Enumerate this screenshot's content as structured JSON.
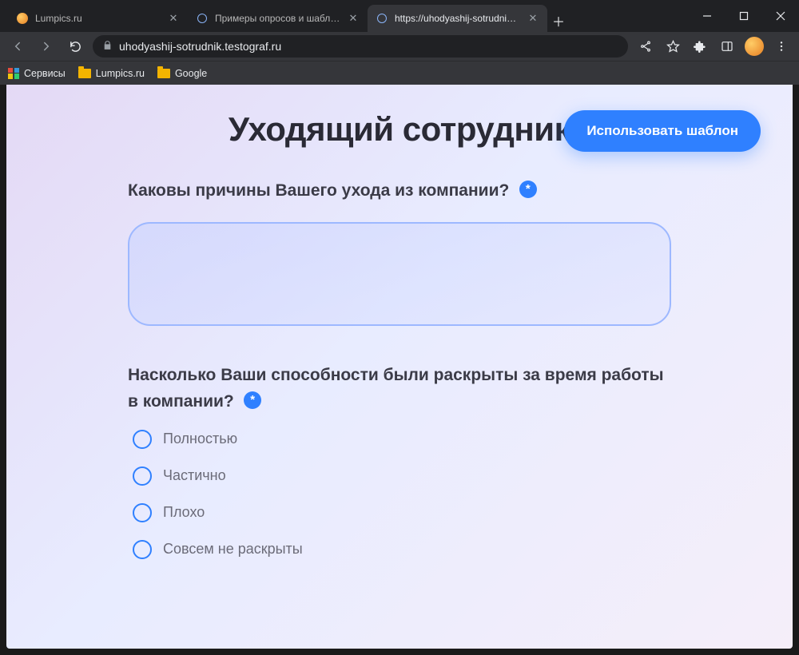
{
  "window": {
    "tabs": [
      {
        "title": "Lumpics.ru",
        "favicon": "orange",
        "active": false
      },
      {
        "title": "Примеры опросов и шаблоны",
        "favicon": "ring",
        "active": false
      },
      {
        "title": "https://uhodyashij-sotrudnik.te",
        "favicon": "ring",
        "active": true
      }
    ]
  },
  "address": "uhodyashij-sotrudnik.testograf.ru",
  "bookmarks": [
    {
      "label": "Сервисы",
      "icon": "grid"
    },
    {
      "label": "Lumpics.ru",
      "icon": "folder"
    },
    {
      "label": "Google",
      "icon": "folder"
    }
  ],
  "page": {
    "title": "Уходящий сотрудник",
    "cta": "Использовать шаблон",
    "required_marker": "*",
    "q1": {
      "label": "Каковы причины Вашего ухода из компании?",
      "value": ""
    },
    "q2": {
      "label": "Насколько Ваши способности были раскрыты за время работы в компании?",
      "options": [
        "Полностью",
        "Частично",
        "Плохо",
        "Совсем не раскрыты"
      ]
    }
  }
}
